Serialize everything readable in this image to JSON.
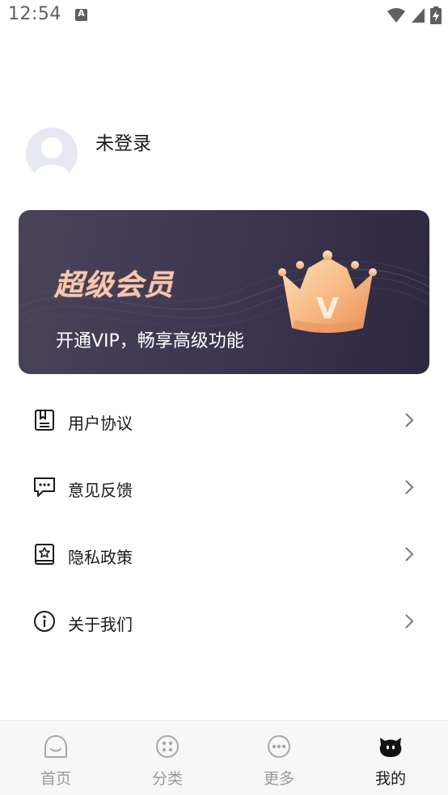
{
  "status_bar": {
    "time": "12:54",
    "notification_glyph": "A",
    "icons": [
      "wifi-icon",
      "signal-icon",
      "battery-charging-icon"
    ]
  },
  "profile": {
    "avatar_icon": "default-avatar-icon",
    "username": "未登录"
  },
  "vip_card": {
    "title": "超级会员",
    "subtitle": "开通VIP，畅享高级功能",
    "crown_letter": "V",
    "colors": {
      "background": "#3e3851",
      "title": "#f6c7ae",
      "crown": "#f5b07a"
    }
  },
  "menu": {
    "items": [
      {
        "label": "用户协议",
        "icon": "document-icon"
      },
      {
        "label": "意见反馈",
        "icon": "feedback-icon"
      },
      {
        "label": "隐私政策",
        "icon": "privacy-star-icon"
      },
      {
        "label": "关于我们",
        "icon": "info-icon"
      }
    ]
  },
  "bottom_nav": {
    "items": [
      {
        "label": "首页",
        "icon": "home-face-icon",
        "active": false
      },
      {
        "label": "分类",
        "icon": "category-dots-icon",
        "active": false
      },
      {
        "label": "更多",
        "icon": "more-dots-icon",
        "active": false
      },
      {
        "label": "我的",
        "icon": "mine-cat-icon",
        "active": true
      }
    ],
    "colors": {
      "active": "#1a1a1a",
      "inactive": "#9a9a9a"
    }
  }
}
